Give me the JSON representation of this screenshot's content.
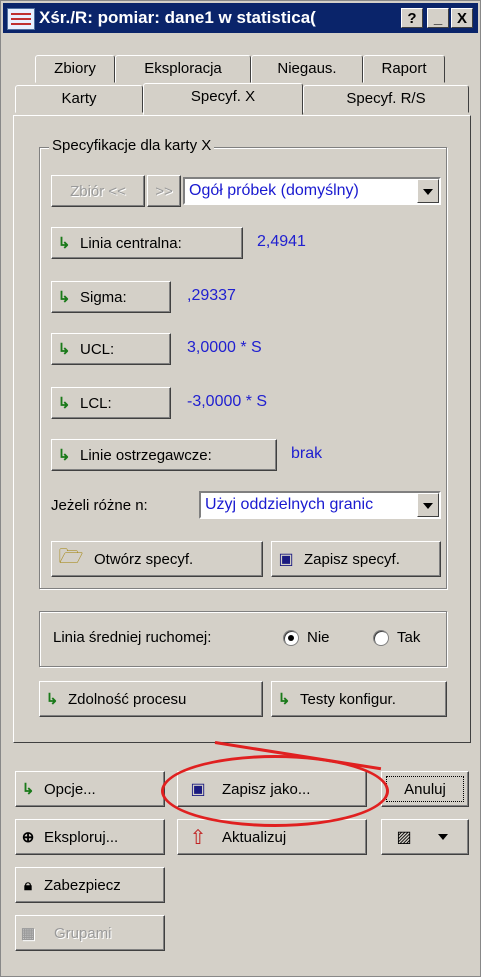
{
  "window": {
    "title": "Xśr./R: pomiar: dane1 w statistica(",
    "help": "?",
    "minimize": "_",
    "close": "X"
  },
  "tabs_row1": [
    "Zbiory",
    "Eksploracja",
    "Niegaus.",
    "Raport"
  ],
  "tabs_row2": [
    "Karty",
    "Specyf. X",
    "Specyf. R/S"
  ],
  "spec_group": {
    "legend": "Specyfikacje dla karty X",
    "zbior_prev": "Zbiór <<",
    "zbior_next": ">>",
    "sample_select": "Ogół próbek (domyślny)",
    "center_line_btn": "Linia centralna:",
    "center_line_val": "2,4941",
    "sigma_btn": "Sigma:",
    "sigma_val": ",29337",
    "ucl_btn": "UCL:",
    "ucl_val": "3,0000 * S",
    "lcl_btn": "LCL:",
    "lcl_val": "-3,0000 * S",
    "warning_btn": "Linie ostrzegawcze:",
    "warning_val": "brak",
    "diff_n_label": "Jeżeli różne n:",
    "diff_n_select": "Użyj oddzielnych granic",
    "open_spec": "Otwórz specyf.",
    "save_spec": "Zapisz specyf."
  },
  "moving_avg": {
    "label": "Linia średniej ruchomej:",
    "no": "Nie",
    "yes": "Tak",
    "selected": "Nie"
  },
  "capability_btn": "Zdolność procesu",
  "tests_btn": "Testy konfigur.",
  "bottom": {
    "options": "Opcje...",
    "save_as": "Zapisz jako...",
    "cancel": "Anuluj",
    "explore": "Eksploruj...",
    "update": "Aktualizuj",
    "protect": "Zabezpiecz",
    "groups": "Grupami"
  },
  "colors": {
    "title_bg": "#0a246a",
    "value_text": "#2020d0",
    "annotation": "#e02020"
  }
}
